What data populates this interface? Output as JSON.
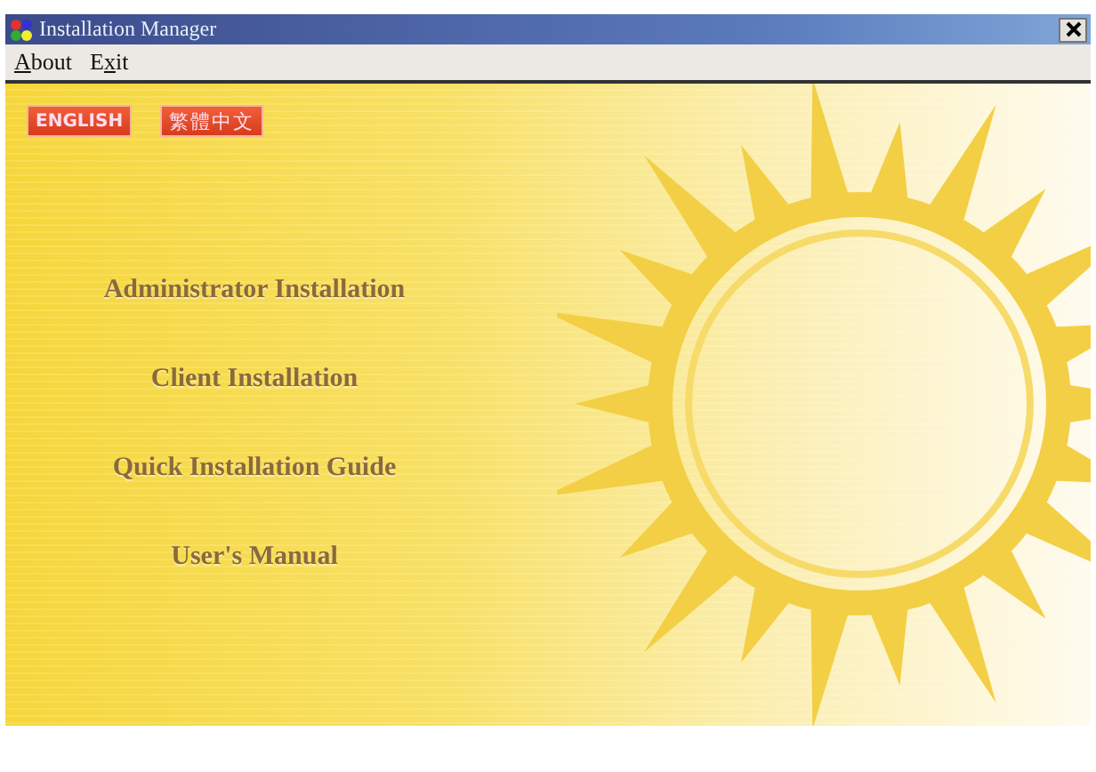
{
  "window": {
    "title": "Installation Manager"
  },
  "menu": [
    {
      "key": "A",
      "after": "bout"
    },
    {
      "before": "E",
      "key": "x",
      "after": "it"
    }
  ],
  "languages": [
    {
      "label": "ENGLISH",
      "kind": "latin"
    },
    {
      "label": "繁體中文",
      "kind": "cjk"
    }
  ],
  "links": [
    "Administrator Installation",
    "Client Installation",
    "Quick Installation Guide",
    "User's Manual"
  ]
}
